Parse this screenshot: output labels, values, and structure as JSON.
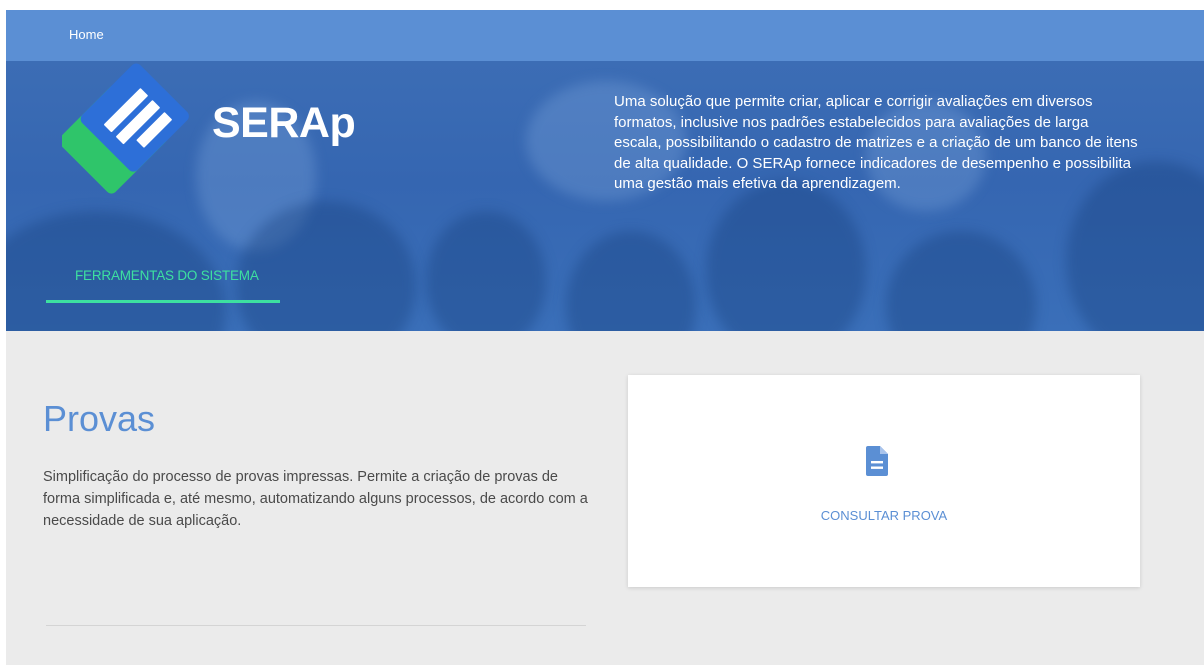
{
  "nav": {
    "home_label": "Home"
  },
  "hero": {
    "brand_name": "SERAp",
    "description": "Uma solução que permite criar, aplicar e corrigir avaliações em diversos formatos, inclusive nos padrões estabelecidos para avaliações de larga escala, possibilitando o cadastro de matrizes e a criação de um banco de itens de alta qualidade. O SERAp fornece indicadores de desempenho e possibilita uma gestão mais efetiva da aprendizagem.",
    "tab_label": "FERRAMENTAS DO SISTEMA"
  },
  "section": {
    "title": "Provas",
    "description": "Simplificação do processo de provas impressas. Permite a criação de provas de forma simplificada e, até mesmo, automatizando alguns processos, de acordo com a necessidade de sua aplicação."
  },
  "card": {
    "icon": "document-icon",
    "label": "CONSULTAR PROVA"
  },
  "colors": {
    "nav_bar": "#5b8fd4",
    "hero_bg": "#3566b1",
    "accent_green": "#3de0a0",
    "accent_blue": "#5b8fd4",
    "page_bg": "#ebebeb",
    "logo_blue": "#2d6fd8",
    "logo_green": "#2fc56a"
  }
}
